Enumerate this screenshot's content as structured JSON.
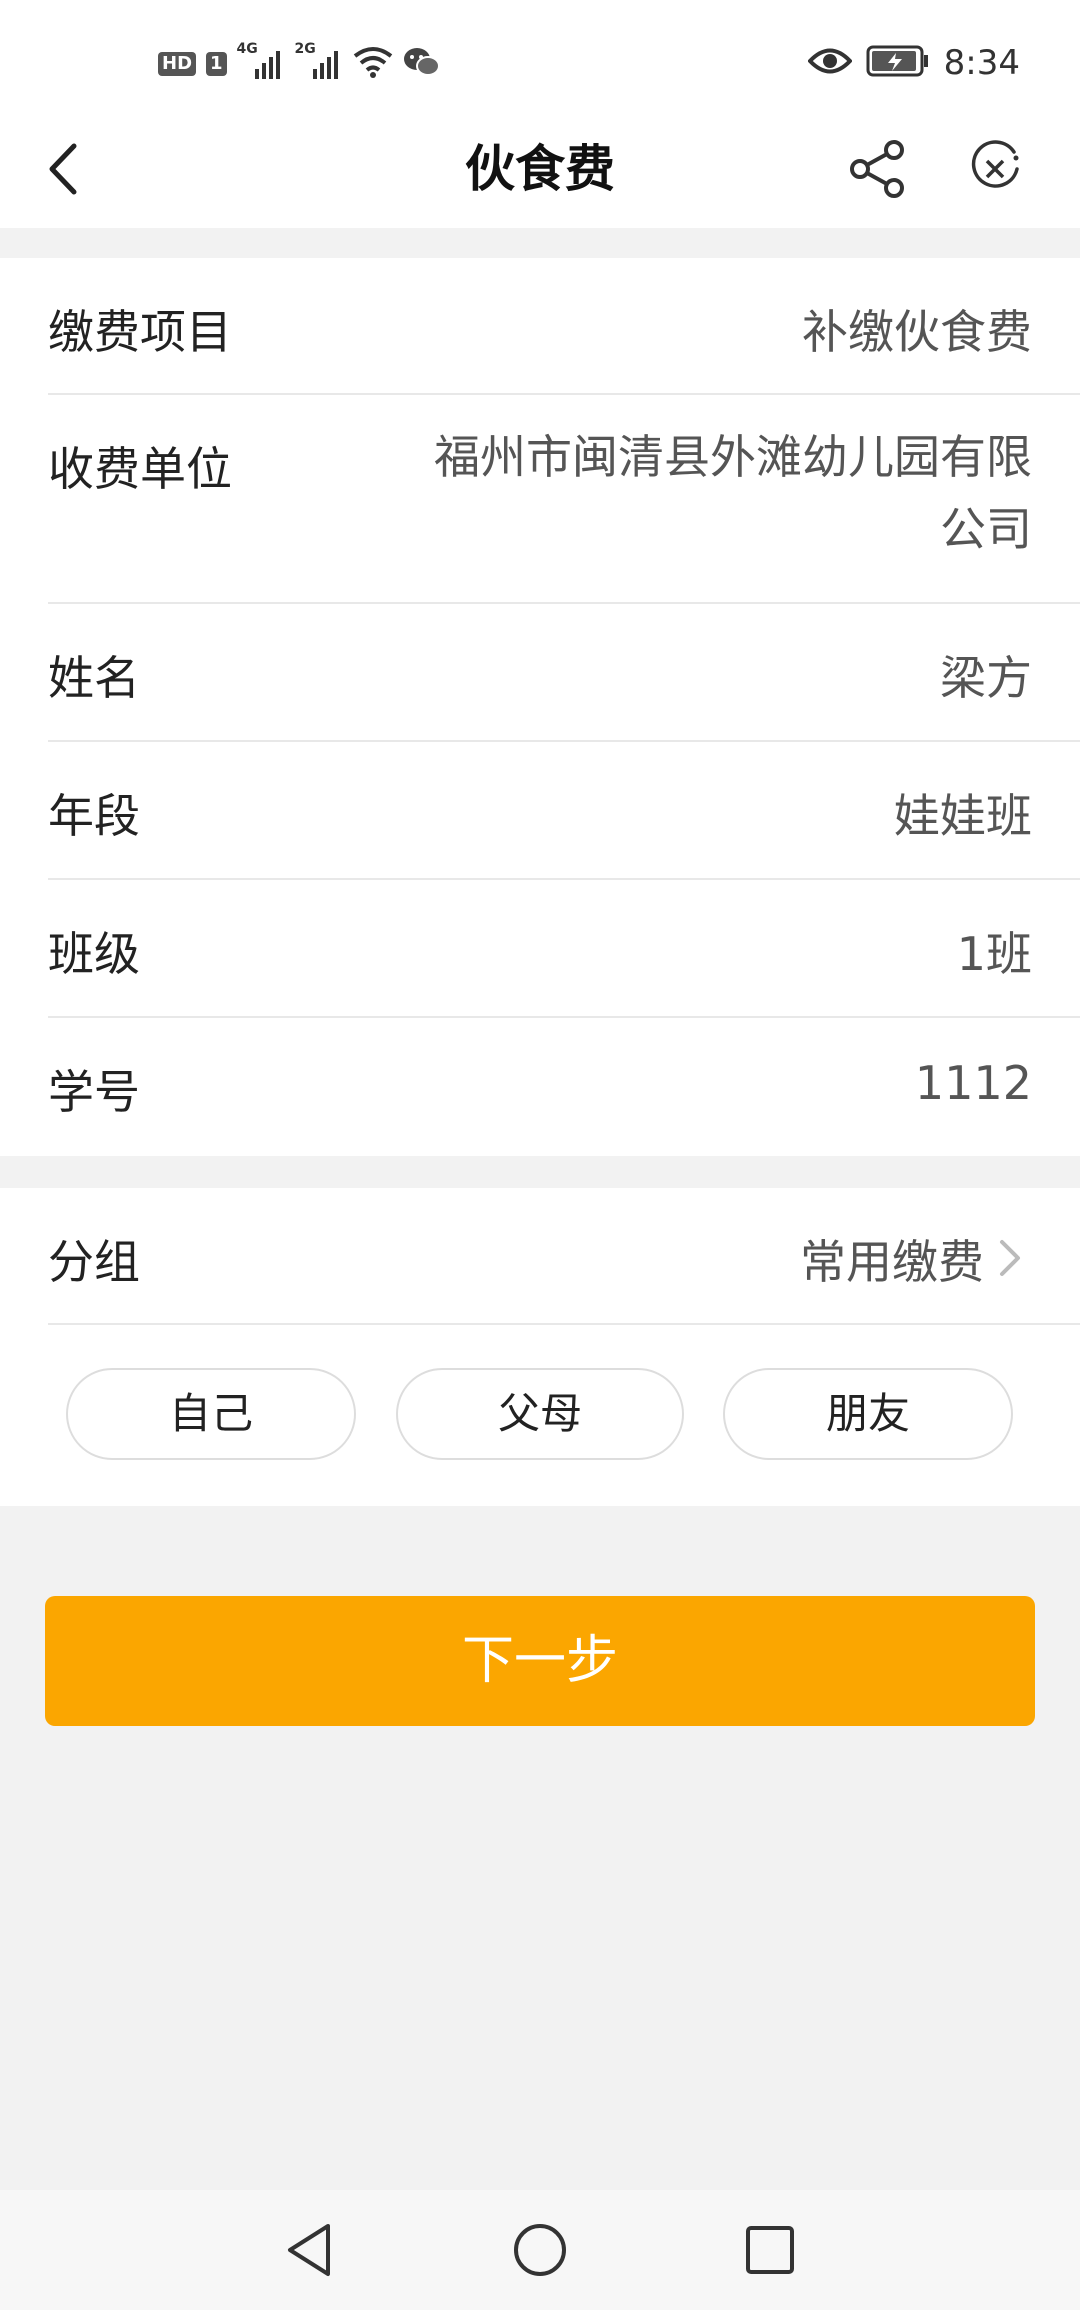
{
  "status_bar": {
    "hd_badge": "HD",
    "sim_badge": "1",
    "net1": "4G",
    "net2": "2G",
    "time": "8:34"
  },
  "nav": {
    "title": "伙食费"
  },
  "details": [
    {
      "label": "缴费项目",
      "value": "补缴伙食费"
    },
    {
      "label": "收费单位",
      "value": "福州市闽清县外滩幼儿园有限公司"
    },
    {
      "label": "姓名",
      "value": "梁方"
    },
    {
      "label": "年段",
      "value": "娃娃班"
    },
    {
      "label": "班级",
      "value": "1班"
    },
    {
      "label": "学号",
      "value": "1112"
    }
  ],
  "group": {
    "label": "分组",
    "value": "常用缴费"
  },
  "chips": [
    "自己",
    "父母",
    "朋友"
  ],
  "next_button": "下一步",
  "colors": {
    "accent": "#fba600",
    "background": "#f2f2f2"
  }
}
